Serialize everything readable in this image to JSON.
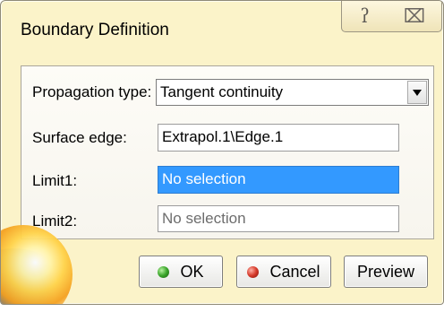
{
  "window": {
    "title": "Boundary Definition",
    "help_icon": "help-icon",
    "close_icon": "close-icon"
  },
  "form": {
    "propagation_label": "Propagation type:",
    "propagation_value": "Tangent continuity",
    "surface_edge_label": "Surface edge:",
    "surface_edge_value": "Extrapol.1\\Edge.1",
    "limit1_label": "Limit1:",
    "limit1_value": "No selection",
    "limit2_label": "Limit2:",
    "limit2_value": "No selection"
  },
  "buttons": {
    "ok_label": "OK",
    "cancel_label": "Cancel",
    "preview_label": "Preview"
  },
  "colors": {
    "dialog_bg": "#fbf3c9",
    "selection": "#3399ff",
    "ok_dot": "#3aa52a",
    "cancel_dot": "#d63a2a"
  }
}
